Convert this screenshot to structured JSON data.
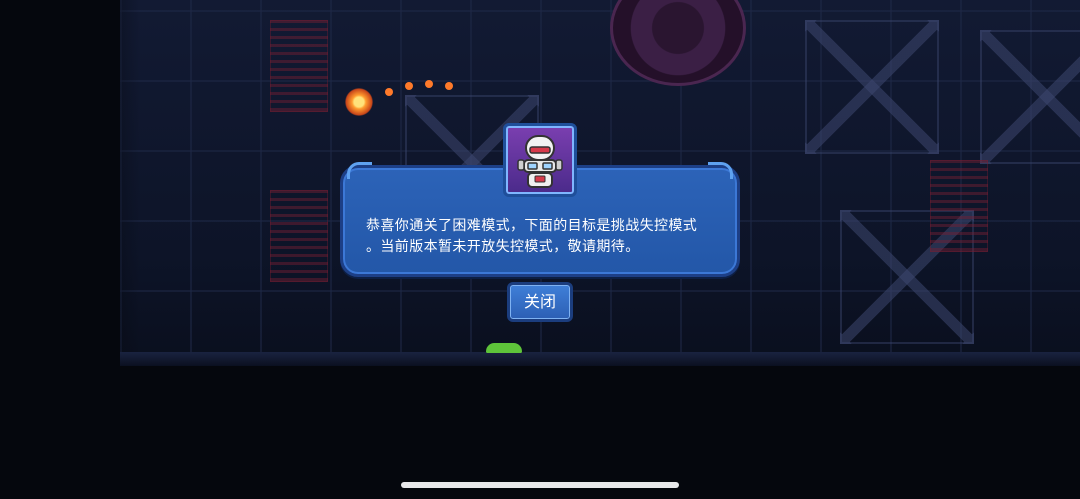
{
  "dialog": {
    "message_line1": "恭喜你通关了困难模式，下面的目标是挑战失控模式",
    "message_line2": "。当前版本暂未开放失控模式，敬请期待。",
    "close_label": "关闭",
    "portrait_icon": "robot-character-icon"
  },
  "colors": {
    "dialog_bg": "#2357a8",
    "dialog_border": "#1d3f86",
    "button_bg": "#3f7fd8",
    "text": "#ffffff"
  }
}
